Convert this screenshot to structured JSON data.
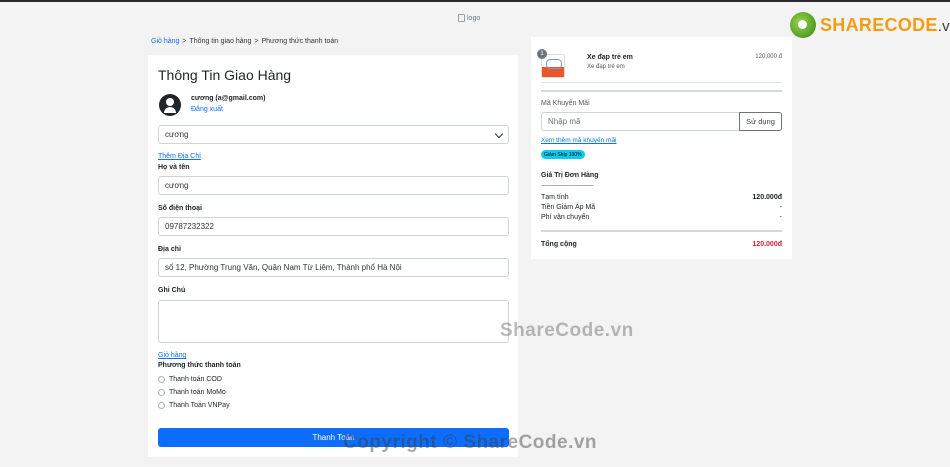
{
  "header": {
    "logo_alt": "logo"
  },
  "brand": {
    "name": "SHARECODE",
    "suffix": ".vn"
  },
  "breadcrumb": {
    "cart": "Giỏ hàng",
    "sep1": ">",
    "shipping_info": "Thông tin giao hàng",
    "sep2": ">",
    "payment_method": "Phương thức thanh toán"
  },
  "shipping": {
    "title": "Thông Tin Giao Hàng",
    "user_display": "cương (a@gmail.com)",
    "logout": "Đăng xuất",
    "address_select_value": "cương",
    "add_address": "Thêm Địa Chỉ",
    "name_label": "Họ và tên",
    "name_value": "cương",
    "phone_label": "Số điện thoại",
    "phone_value": "09787232322",
    "address_label": "Địa chỉ",
    "address_value": "số 12, Phường Trung Văn, Quận Nam Từ Liêm, Thành phố Hà Nội",
    "note_label": "Ghi Chú",
    "note_value": "",
    "cart_link": "Giỏ hàng",
    "payment_label": "Phương thức thanh toán",
    "payment_options": [
      "Thanh toán COD",
      "Thanh toán MoMo",
      "Thanh Toán VNPay"
    ],
    "submit_label": "Thanh Toán"
  },
  "order": {
    "item": {
      "quantity": "1",
      "name": "Xe đạp trẻ em",
      "subtitle": "Xe đạp trẻ em",
      "price": "120,000 đ"
    },
    "promo_label": "Mã Khuyến Mãi",
    "promo_placeholder": "Nhập mã",
    "promo_button": "Sử dụng",
    "more_promos": "Xem thêm mã khuyến mãi",
    "badge": "Giảm Ship 100%",
    "summary_title": "Giá Trị Đơn Hàng",
    "summary_divider": "-----------------------------------",
    "rows": [
      {
        "label": "Tạm tính",
        "value": "120.000đ"
      },
      {
        "label": "Tiền Giảm Áp Mã",
        "value": "-"
      },
      {
        "label": "Phí vận chuyển",
        "value": "-"
      }
    ],
    "total_label": "Tổng cộng",
    "total_value": "120.000đ"
  },
  "watermarks": {
    "center": "ShareCode.vn",
    "bottom": "Copyright © ShareCode.vn"
  }
}
